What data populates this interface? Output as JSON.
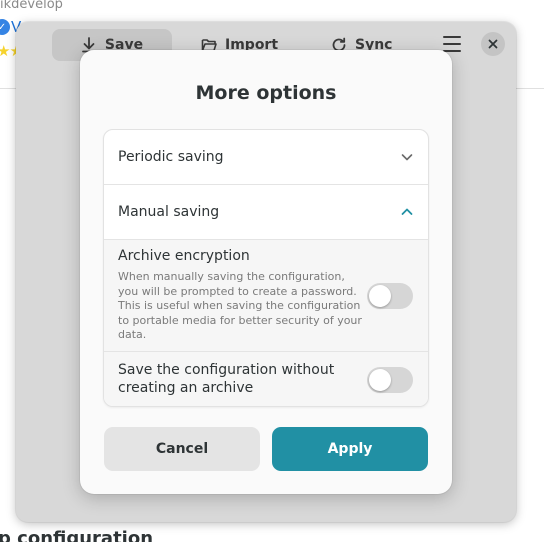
{
  "background": {
    "author": "ikdevelop",
    "verified_letter": "V",
    "stars": "★★",
    "heading": "p configuration"
  },
  "toolbar": {
    "save_label": "Save",
    "import_label": "Import",
    "sync_label": "Sync"
  },
  "dialog": {
    "title": "More options",
    "sections": [
      {
        "label": "Periodic saving",
        "expanded": false
      },
      {
        "label": "Manual saving",
        "expanded": true
      }
    ],
    "archive_encryption": {
      "title": "Archive encryption",
      "description": "When manually saving the configuration, you will be prompted to create a password. This is useful when saving the configuration to portable media for better security of your data.",
      "enabled": false
    },
    "save_without_archive": {
      "title": "Save the configuration without creating an archive",
      "enabled": false
    },
    "cancel_label": "Cancel",
    "apply_label": "Apply"
  },
  "colors": {
    "accent": "#2190a4",
    "dialog_bg": "#fafafa",
    "window_dimmed": "#d8d8d8"
  }
}
